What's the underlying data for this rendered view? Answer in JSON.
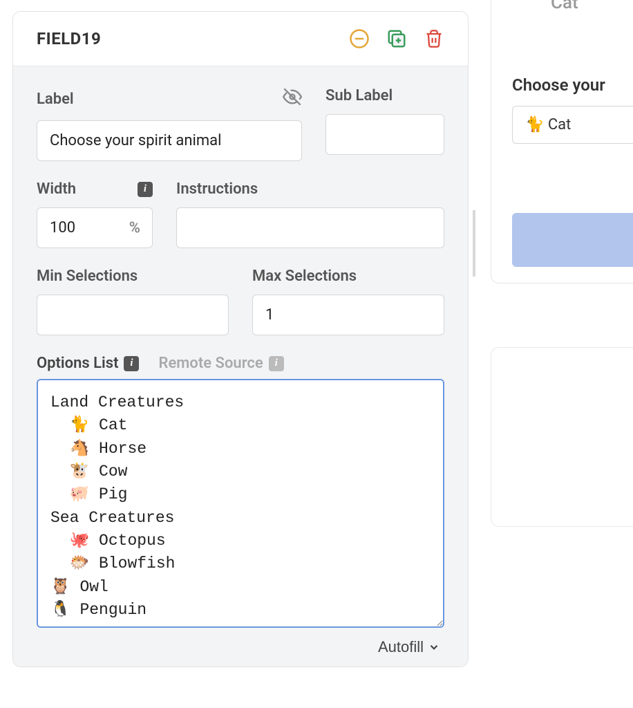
{
  "header": {
    "field_id": "FIELD19"
  },
  "form": {
    "label": {
      "title": "Label",
      "value": "Choose your spirit animal"
    },
    "sublabel": {
      "title": "Sub Label",
      "value": ""
    },
    "width": {
      "title": "Width",
      "value": "100",
      "suffix": "%"
    },
    "instructions": {
      "title": "Instructions",
      "value": ""
    },
    "min_selections": {
      "title": "Min Selections",
      "value": ""
    },
    "max_selections": {
      "title": "Max Selections",
      "value": "1"
    },
    "tabs": {
      "options_list": "Options List",
      "remote_source": "Remote Source"
    },
    "options_text": "Land Creatures\n  🐈 Cat\n  🐴 Horse\n  🐮 Cow\n  🐖 Pig\nSea Creatures\n  🐙 Octopus\n  🐡 Blowfish\n🦉 Owl\n🐧 Penguin",
    "autofill": "Autofill"
  },
  "preview": {
    "top_faded": "Cat",
    "label": "Choose your",
    "selected": "🐈 Cat"
  },
  "icons": {
    "info": "i"
  }
}
